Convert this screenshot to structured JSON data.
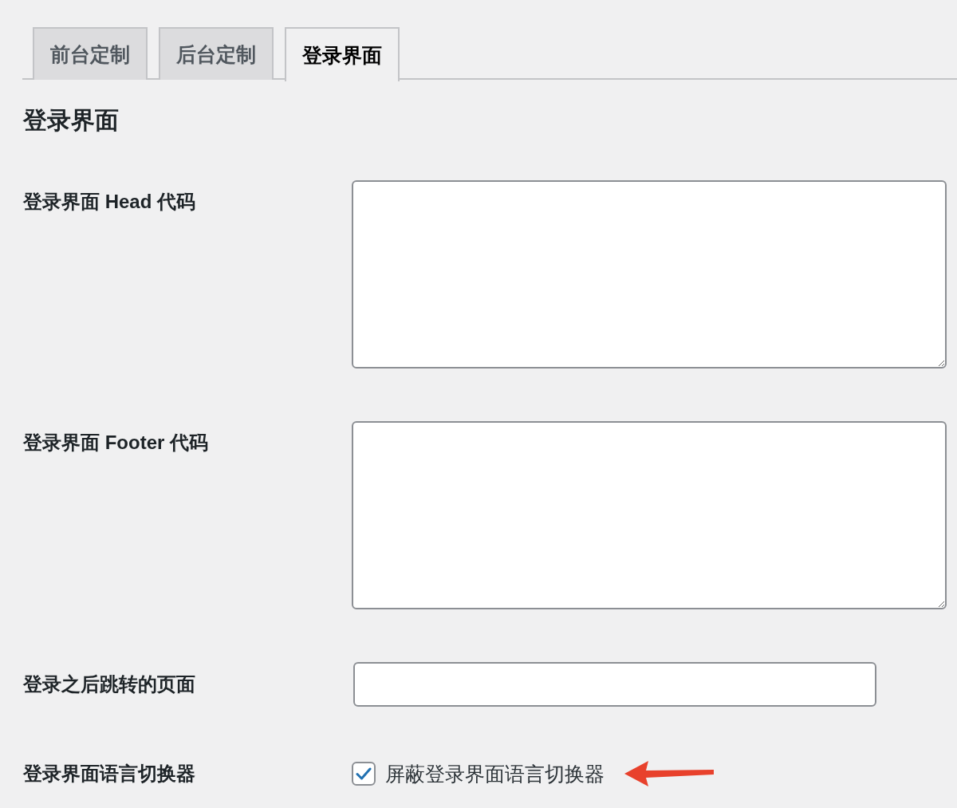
{
  "tabs": [
    {
      "label": "前台定制",
      "selected": false
    },
    {
      "label": "后台定制",
      "selected": false
    },
    {
      "label": "登录界面",
      "selected": true
    }
  ],
  "heading": "登录界面",
  "fields": [
    {
      "kind": "textarea",
      "label": "登录界面 Head 代码"
    },
    {
      "kind": "textarea",
      "label": "登录界面 Footer 代码"
    },
    {
      "kind": "text",
      "label": "登录之后跳转的页面"
    },
    {
      "kind": "checkbox",
      "label": "登录界面语言切换器",
      "option": "屏蔽登录界面语言切换器",
      "checked": true
    }
  ]
}
